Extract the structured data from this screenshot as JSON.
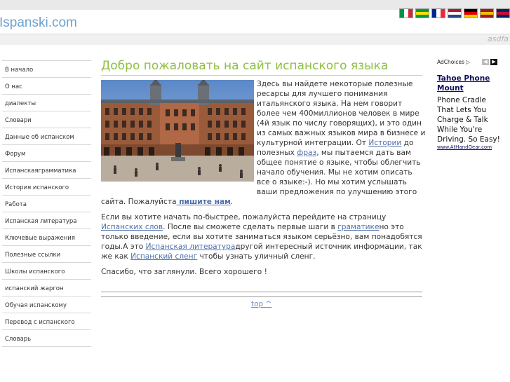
{
  "site": {
    "logo": "Ispanski.com",
    "sub_text": "asdfa"
  },
  "flags": [
    {
      "name": "italy-flag",
      "colors": [
        "#009246",
        "#ffffff",
        "#ce2b37"
      ],
      "dir": "v"
    },
    {
      "name": "brazil-flag",
      "colors": [
        "#009c3b",
        "#ffdf00",
        "#009c3b"
      ],
      "dir": "h"
    },
    {
      "name": "france-flag",
      "colors": [
        "#002395",
        "#ffffff",
        "#ed2939"
      ],
      "dir": "v"
    },
    {
      "name": "netherlands-flag",
      "colors": [
        "#ae1c28",
        "#ffffff",
        "#21468b"
      ],
      "dir": "h"
    },
    {
      "name": "germany-flag",
      "colors": [
        "#000000",
        "#dd0000",
        "#ffce00"
      ],
      "dir": "h"
    },
    {
      "name": "spain-flag",
      "colors": [
        "#aa151b",
        "#f1bf00",
        "#aa151b"
      ],
      "dir": "h"
    },
    {
      "name": "uk-flag",
      "colors": [
        "#012169",
        "#c8102e",
        "#012169"
      ],
      "dir": "h"
    }
  ],
  "sidebar": {
    "items": [
      "В начало",
      "О нас",
      "диалекты",
      "Словари",
      "Данные об испанском",
      "Форум",
      "Испанскаяграмматика",
      "История испанского",
      "Работа",
      "Испанская литература",
      "Ключевые выражения",
      "Полезные ссылки",
      "Школы испанского",
      "испанский жаргон",
      "Обучая испанскому",
      "Перевод с испанского",
      "Словарь"
    ]
  },
  "main": {
    "title": "Добро пожаловать на сайт испанского языка",
    "p1_a": "Здесь вы найдете некоторые полезные ресарсы для лучшего понимания итальянского языка. На нем говорит более чем  400миллионов человек в мире  (4й язык по числу говорящих), и это один из самых важных языков мира в бизнесе и культурной интеграции. От",
    "link_history": "Истории",
    "p1_b": "до полезных",
    "link_phrases": "фраз",
    "p1_c": ", мы пытаемся дать вам общее понятие о языке, чтобы облегчить начало обучения. Мы не хотим описать все о языке:-). Но мы хотим услышать ваши предложения по улучшению этого сайта.",
    "p1_please": "Пожалуйста",
    "link_write": " пишите нам",
    "p1_end": ".",
    "p2_a": "Если вы хотите начать по-быстрее, пожалуйста перейдите на страницу",
    "link_words": "Испанских слов",
    "p2_b": ". После вы сможете сделать первые шаги в",
    "link_grammar": "граматике",
    "p2_c": "но это только введение, если вы хотите заниматься языком серьёзно, вам понадобятся годы.А это",
    "link_literature": "Испанская литература",
    "p2_d": "другой интересный источник информации, так же как",
    "link_slang": "Испанский сленг",
    "p2_e": "чтобы узнать уличный сленг.",
    "p3": "Спасибо, что заглянули. Всего хорошего !",
    "top_link": "top ^"
  },
  "ads": {
    "adchoices": "AdChoices",
    "title": "Tahoe Phone Mount",
    "body": "Phone Cradle That Lets You Charge & Talk While You're Driving. So Easy!",
    "url": "www.AtHandGear.com"
  }
}
